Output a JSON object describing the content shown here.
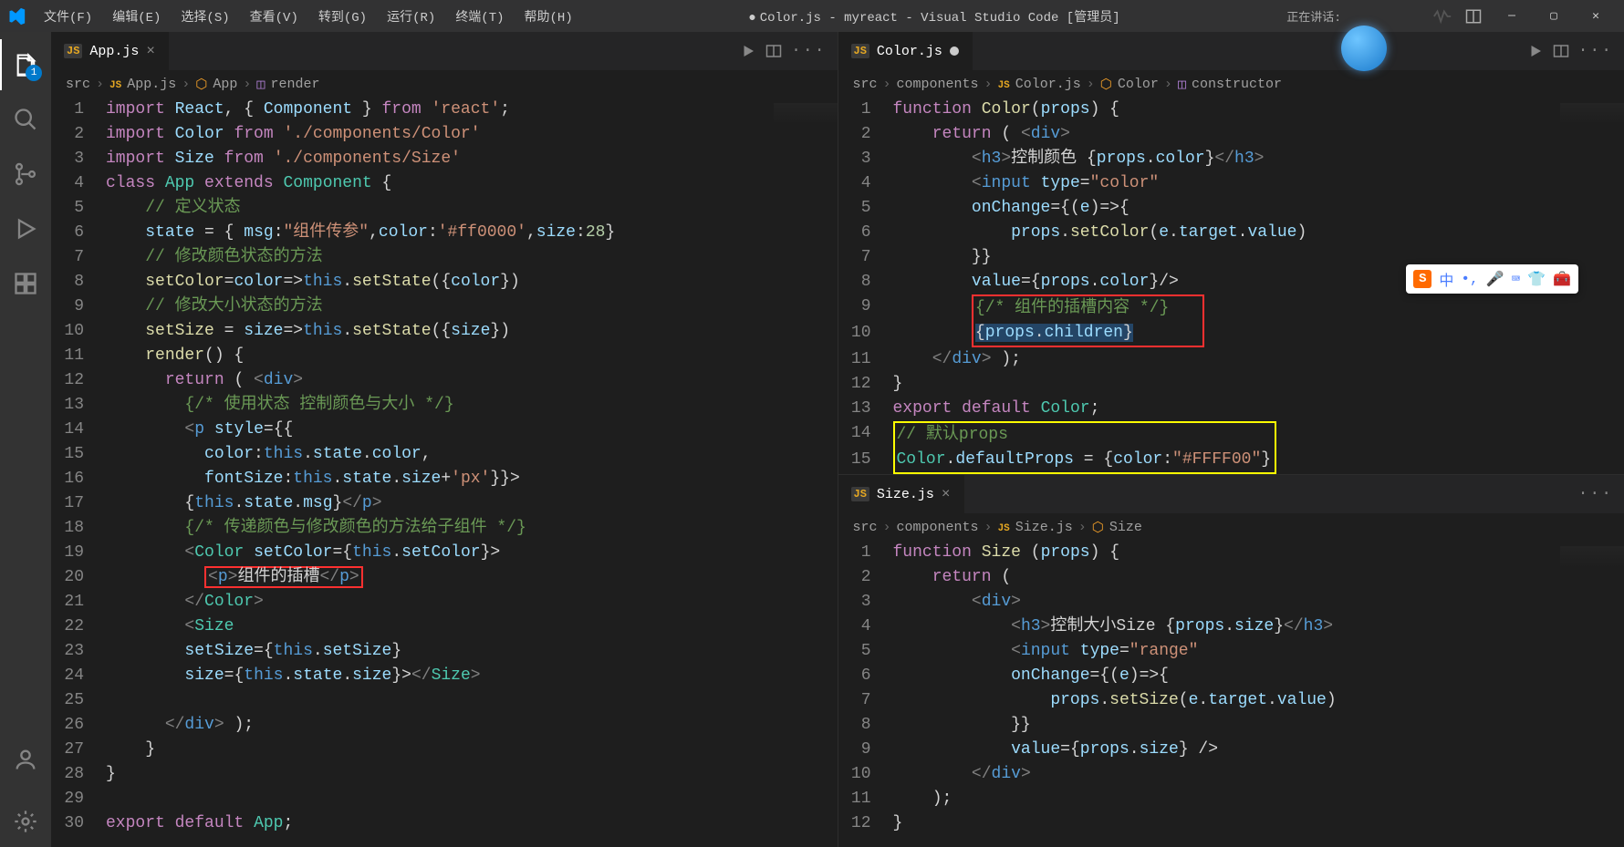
{
  "titlebar": {
    "menus": [
      "文件(F)",
      "编辑(E)",
      "选择(S)",
      "查看(V)",
      "转到(G)",
      "运行(R)",
      "终端(T)",
      "帮助(H)"
    ],
    "title": "Color.js - myreact - Visual Studio Code [管理员]",
    "talking": "正在讲话:"
  },
  "activity": {
    "badge": "1"
  },
  "left": {
    "tab": {
      "label": "App.js"
    },
    "breadcrumb": [
      "src",
      "App.js",
      "App",
      "render"
    ],
    "lines": [
      {
        "n": "1",
        "html": "<span class='kw'>import</span> <span class='var'>React</span><span class='punc'>, { </span><span class='var'>Component</span><span class='punc'> } </span><span class='kw'>from</span> <span class='str'>'react'</span><span class='punc'>;</span>"
      },
      {
        "n": "2",
        "html": "<span class='kw'>import</span> <span class='var'>Color</span> <span class='kw'>from</span> <span class='str'>'./components/Color'</span>"
      },
      {
        "n": "3",
        "html": "<span class='kw'>import</span> <span class='var'>Size</span> <span class='kw'>from</span> <span class='str'>'./components/Size'</span>"
      },
      {
        "n": "4",
        "html": "<span class='kw'>class</span> <span class='cls'>App</span> <span class='kw'>extends</span> <span class='cls'>Component</span> <span class='punc'>{</span>"
      },
      {
        "n": "5",
        "html": "    <span class='cmt'>// 定义状态</span>"
      },
      {
        "n": "6",
        "html": "    <span class='var'>state</span> <span class='op'>=</span> <span class='punc'>{ </span><span class='var'>msg</span><span class='punc'>:</span><span class='str'>\"组件传参\"</span><span class='punc'>,</span><span class='var'>color</span><span class='punc'>:</span><span class='str'>'#ff0000'</span><span class='punc'>,</span><span class='var'>size</span><span class='punc'>:</span><span class='num'>28</span><span class='punc'>}</span>"
      },
      {
        "n": "7",
        "html": "    <span class='cmt'>// 修改颜色状态的方法</span>"
      },
      {
        "n": "8",
        "html": "    <span class='fn'>setColor</span><span class='op'>=</span><span class='var'>color</span><span class='op'>=&gt;</span><span class='this'>this</span><span class='punc'>.</span><span class='fn'>setState</span><span class='punc'>({</span><span class='var'>color</span><span class='punc'>})</span>"
      },
      {
        "n": "9",
        "html": "    <span class='cmt'>// 修改大小状态的方法</span>"
      },
      {
        "n": "10",
        "html": "    <span class='fn'>setSize</span> <span class='op'>=</span> <span class='var'>size</span><span class='op'>=&gt;</span><span class='this'>this</span><span class='punc'>.</span><span class='fn'>setState</span><span class='punc'>({</span><span class='var'>size</span><span class='punc'>})</span>"
      },
      {
        "n": "11",
        "html": "    <span class='fn'>render</span><span class='punc'>() {</span>"
      },
      {
        "n": "12",
        "html": "      <span class='kw'>return</span> <span class='punc'>( </span><span class='tag'>&lt;</span><span class='htmltag'>div</span><span class='tag'>&gt;</span>"
      },
      {
        "n": "13",
        "html": "        <span class='cmt'>{/* 使用状态 控制颜色与大小 */}</span>"
      },
      {
        "n": "14",
        "html": "        <span class='tag'>&lt;</span><span class='htmltag'>p</span> <span class='attr'>style</span><span class='op'>=</span><span class='punc'>{{</span>"
      },
      {
        "n": "15",
        "html": "          <span class='var'>color</span><span class='punc'>:</span><span class='this'>this</span><span class='punc'>.</span><span class='var'>state</span><span class='punc'>.</span><span class='var'>color</span><span class='punc'>,</span>"
      },
      {
        "n": "16",
        "html": "          <span class='var'>fontSize</span><span class='punc'>:</span><span class='this'>this</span><span class='punc'>.</span><span class='var'>state</span><span class='punc'>.</span><span class='var'>size</span><span class='op'>+</span><span class='str'>'px'</span><span class='punc'>}}&gt;</span>"
      },
      {
        "n": "17",
        "html": "        <span class='punc'>{</span><span class='this'>this</span><span class='punc'>.</span><span class='var'>state</span><span class='punc'>.</span><span class='var'>msg</span><span class='punc'>}</span><span class='tag'>&lt;/</span><span class='htmltag'>p</span><span class='tag'>&gt;</span>"
      },
      {
        "n": "18",
        "html": "        <span class='cmt'>{/* 传递颜色与修改颜色的方法给子组件 */}</span>"
      },
      {
        "n": "19",
        "html": "        <span class='tag'>&lt;</span><span class='tagname'>Color</span> <span class='attr'>setColor</span><span class='op'>=</span><span class='punc'>{</span><span class='this'>this</span><span class='punc'>.</span><span class='var'>setColor</span><span class='punc'>}&gt;</span>"
      },
      {
        "n": "20",
        "html": "          <span class='box-red'><span class='tag'>&lt;</span><span class='htmltag'>p</span><span class='tag'>&gt;</span><span class='punc'>组件的插槽</span><span class='tag'>&lt;/</span><span class='htmltag'>p</span><span class='tag'>&gt;</span></span>"
      },
      {
        "n": "21",
        "html": "        <span class='tag'>&lt;/</span><span class='tagname'>Color</span><span class='tag'>&gt;</span>"
      },
      {
        "n": "22",
        "html": "        <span class='tag'>&lt;</span><span class='tagname'>Size</span>"
      },
      {
        "n": "23",
        "html": "        <span class='attr'>setSize</span><span class='op'>=</span><span class='punc'>{</span><span class='this'>this</span><span class='punc'>.</span><span class='var'>setSize</span><span class='punc'>}</span>"
      },
      {
        "n": "24",
        "html": "        <span class='attr'>size</span><span class='op'>=</span><span class='punc'>{</span><span class='this'>this</span><span class='punc'>.</span><span class='var'>state</span><span class='punc'>.</span><span class='var'>size</span><span class='punc'>}&gt;</span><span class='tag'>&lt;/</span><span class='tagname'>Size</span><span class='tag'>&gt;</span>"
      },
      {
        "n": "25",
        "html": ""
      },
      {
        "n": "26",
        "html": "      <span class='tag'>&lt;/</span><span class='htmltag'>div</span><span class='tag'>&gt;</span> <span class='punc'>);</span>"
      },
      {
        "n": "27",
        "html": "    <span class='punc'>}</span>"
      },
      {
        "n": "28",
        "html": "<span class='punc'>}</span>"
      },
      {
        "n": "29",
        "html": ""
      },
      {
        "n": "30",
        "html": "<span class='kw'>export</span> <span class='kw'>default</span> <span class='cls'>App</span><span class='punc'>;</span>"
      }
    ]
  },
  "rightTop": {
    "tab": {
      "label": "Color.js"
    },
    "breadcrumb": [
      "src",
      "components",
      "Color.js",
      "Color",
      "constructor"
    ],
    "lines": [
      {
        "n": "1",
        "html": "<span class='kw'>function</span> <span class='fn'>Color</span><span class='punc'>(</span><span class='var'>props</span><span class='punc'>) {</span>"
      },
      {
        "n": "2",
        "html": "    <span class='kw'>return</span> <span class='punc'>( </span><span class='tag'>&lt;</span><span class='htmltag'>div</span><span class='tag'>&gt;</span>"
      },
      {
        "n": "3",
        "html": "        <span class='tag'>&lt;</span><span class='htmltag'>h3</span><span class='tag'>&gt;</span><span class='punc'>控制颜色 {</span><span class='var'>props</span><span class='punc'>.</span><span class='var'>color</span><span class='punc'>}</span><span class='tag'>&lt;/</span><span class='htmltag'>h3</span><span class='tag'>&gt;</span>"
      },
      {
        "n": "4",
        "html": "        <span class='tag'>&lt;</span><span class='htmltag'>input</span> <span class='attr'>type</span><span class='op'>=</span><span class='str'>\"color\"</span>"
      },
      {
        "n": "5",
        "html": "        <span class='attr'>onChange</span><span class='op'>=</span><span class='punc'>{(</span><span class='var'>e</span><span class='punc'>)=&gt;{</span>"
      },
      {
        "n": "6",
        "html": "            <span class='var'>props</span><span class='punc'>.</span><span class='fn'>setColor</span><span class='punc'>(</span><span class='var'>e</span><span class='punc'>.</span><span class='var'>target</span><span class='punc'>.</span><span class='var'>value</span><span class='punc'>)</span>"
      },
      {
        "n": "7",
        "html": "        <span class='punc'>}}</span>"
      },
      {
        "n": "8",
        "html": "        <span class='attr'>value</span><span class='op'>=</span><span class='punc'>{</span><span class='var'>props</span><span class='punc'>.</span><span class='var'>color</span><span class='punc'>}/&gt;</span>"
      },
      {
        "n": "9",
        "html": "        <span class='box-red-sel2'><span class='cmt'>{/* 组件的插槽内容 */}</span></span>"
      },
      {
        "n": "10",
        "html": "        <span class='box-red-sel3'><span class='punc sel-bg'>{</span><span class='var sel-bg'>props</span><span class='punc sel-bg'>.</span><span class='var sel-bg'>children</span><span class='punc sel-bg'>}</span></span>"
      },
      {
        "n": "11",
        "html": "    <span class='tag'>&lt;/</span><span class='htmltag'>div</span><span class='tag'>&gt;</span> <span class='punc'>);</span>"
      },
      {
        "n": "12",
        "html": "<span class='punc'>}</span>"
      },
      {
        "n": "13",
        "html": "<span class='kw'>export</span> <span class='kw'>default</span> <span class='cls'>Color</span><span class='punc'>;</span>"
      },
      {
        "n": "14",
        "html": "<span class='box-yellow-cmt'><span class='cmt'>// 默认props</span></span>"
      },
      {
        "n": "15",
        "html": "<span class='box-yellow-code'><span class='cls'>Color</span><span class='punc'>.</span><span class='var'>defaultProps</span> <span class='op'>=</span> <span class='punc'>{</span><span class='var'>color</span><span class='punc'>:</span><span class='str'>\"#FFFF00\"</span><span class='punc'>}</span></span>"
      }
    ]
  },
  "rightBottom": {
    "tab": {
      "label": "Size.js"
    },
    "breadcrumb": [
      "src",
      "components",
      "Size.js",
      "Size"
    ],
    "lines": [
      {
        "n": "1",
        "html": "<span class='kw'>function</span> <span class='fn'>Size</span> <span class='punc'>(</span><span class='var'>props</span><span class='punc'>) {</span>"
      },
      {
        "n": "2",
        "html": "    <span class='kw'>return</span> <span class='punc'>(</span>"
      },
      {
        "n": "3",
        "html": "        <span class='tag'>&lt;</span><span class='htmltag'>div</span><span class='tag'>&gt;</span>"
      },
      {
        "n": "4",
        "html": "            <span class='tag'>&lt;</span><span class='htmltag'>h3</span><span class='tag'>&gt;</span><span class='punc'>控制大小Size {</span><span class='var'>props</span><span class='punc'>.</span><span class='var'>size</span><span class='punc'>}</span><span class='tag'>&lt;/</span><span class='htmltag'>h3</span><span class='tag'>&gt;</span>"
      },
      {
        "n": "5",
        "html": "            <span class='tag'>&lt;</span><span class='htmltag'>input</span> <span class='attr'>type</span><span class='op'>=</span><span class='str'>\"range\"</span>"
      },
      {
        "n": "6",
        "html": "            <span class='attr'>onChange</span><span class='op'>=</span><span class='punc'>{(</span><span class='var'>e</span><span class='punc'>)=&gt;{</span>"
      },
      {
        "n": "7",
        "html": "                <span class='var'>props</span><span class='punc'>.</span><span class='fn'>setSize</span><span class='punc'>(</span><span class='var'>e</span><span class='punc'>.</span><span class='var'>target</span><span class='punc'>.</span><span class='var'>value</span><span class='punc'>)</span>"
      },
      {
        "n": "8",
        "html": "            <span class='punc'>}}</span>"
      },
      {
        "n": "9",
        "html": "            <span class='attr'>value</span><span class='op'>=</span><span class='punc'>{</span><span class='var'>props</span><span class='punc'>.</span><span class='var'>size</span><span class='punc'>} /&gt;</span>"
      },
      {
        "n": "10",
        "html": "        <span class='tag'>&lt;/</span><span class='htmltag'>div</span><span class='tag'>&gt;</span>"
      },
      {
        "n": "11",
        "html": "    <span class='punc'>);</span>"
      },
      {
        "n": "12",
        "html": "<span class='punc'>}</span>"
      }
    ]
  },
  "ime": {
    "label": "中"
  }
}
